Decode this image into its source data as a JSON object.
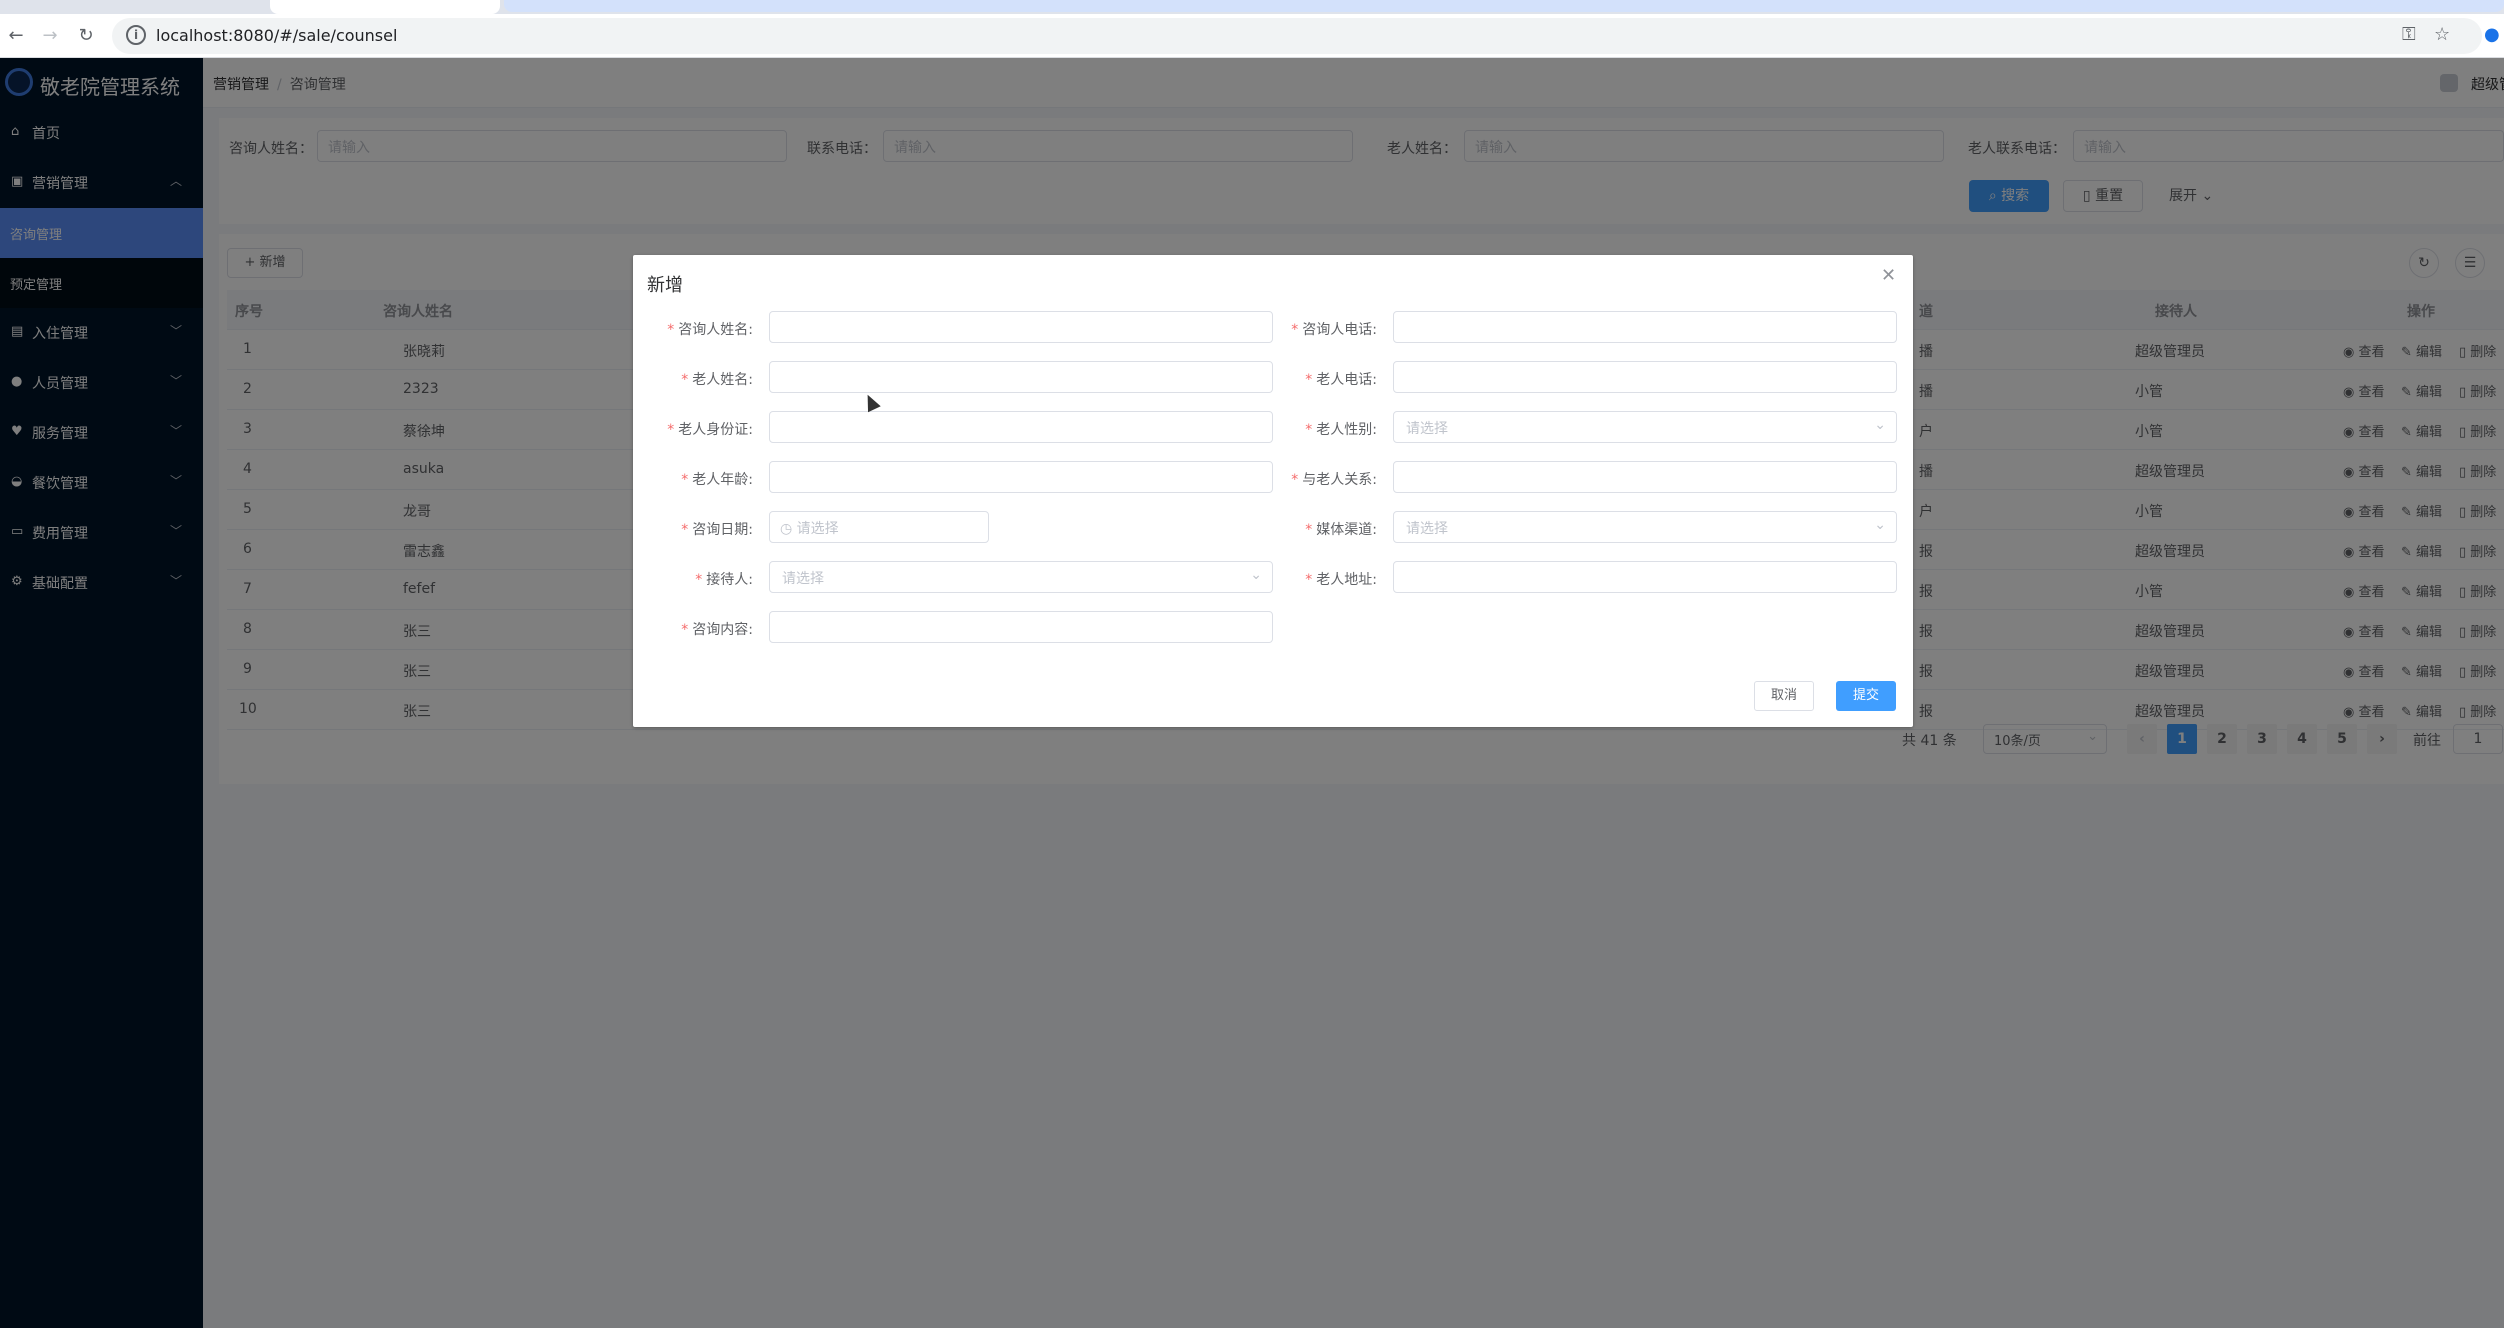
{
  "browser": {
    "url": "localhost:8080/#/sale/counsel"
  },
  "app": {
    "title": "敬老院管理系统",
    "breadcrumb": [
      "营销管理",
      "咨询管理"
    ],
    "user_name": "超级管理员"
  },
  "sidebar": {
    "items": [
      {
        "label": "首页",
        "icon": "home-icon"
      },
      {
        "label": "营销管理",
        "icon": "chart-icon",
        "expanded": true
      },
      {
        "label": "入住管理",
        "icon": "checkin-icon"
      },
      {
        "label": "人员管理",
        "icon": "user-icon"
      },
      {
        "label": "服务管理",
        "icon": "service-icon"
      },
      {
        "label": "餐饮管理",
        "icon": "food-icon"
      },
      {
        "label": "费用管理",
        "icon": "money-icon"
      },
      {
        "label": "基础配置",
        "icon": "gear-icon"
      }
    ],
    "sub_items": [
      {
        "label": "咨询管理",
        "active": true
      },
      {
        "label": "预定管理",
        "active": false
      }
    ]
  },
  "search": {
    "fields": [
      {
        "label": "咨询人姓名：",
        "placeholder": "请输入"
      },
      {
        "label": "联系电话：",
        "placeholder": "请输入"
      },
      {
        "label": "老人姓名：",
        "placeholder": "请输入"
      },
      {
        "label": "老人联系电话：",
        "placeholder": "请输入"
      }
    ],
    "search_label": "搜索",
    "reset_label": "重置",
    "expand_label": "展开"
  },
  "table": {
    "add_label": "+ 新增",
    "columns": {
      "index": "序号",
      "name": "咨询人姓名",
      "channel_fragment": "道",
      "receptionist": "接待人",
      "actions": "操作"
    },
    "actions": {
      "view": "查看",
      "edit": "编辑",
      "delete": "删除"
    },
    "rows": [
      {
        "index": "1",
        "name": "张晓莉",
        "channel_fragment": "播",
        "receptionist": "超级管理员"
      },
      {
        "index": "2",
        "name": "2323",
        "channel_fragment": "播",
        "receptionist": "小管"
      },
      {
        "index": "3",
        "name": "蔡徐坤",
        "channel_fragment": "户",
        "receptionist": "小管"
      },
      {
        "index": "4",
        "name": "asuka",
        "channel_fragment": "播",
        "receptionist": "超级管理员"
      },
      {
        "index": "5",
        "name": "龙哥",
        "channel_fragment": "户",
        "receptionist": "小管"
      },
      {
        "index": "6",
        "name": "雷志鑫",
        "channel_fragment": "报",
        "receptionist": "超级管理员"
      },
      {
        "index": "7",
        "name": "fefef",
        "channel_fragment": "报",
        "receptionist": "小管"
      },
      {
        "index": "8",
        "name": "张三",
        "channel_fragment": "报",
        "receptionist": "超级管理员"
      },
      {
        "index": "9",
        "name": "张三",
        "channel_fragment": "报",
        "receptionist": "超级管理员"
      },
      {
        "index": "10",
        "name": "张三",
        "channel_fragment": "报",
        "receptionist": "超级管理员"
      }
    ]
  },
  "pagination": {
    "total": "共 41 条",
    "page_size": "10条/页",
    "pages": [
      "1",
      "2",
      "3",
      "4",
      "5"
    ],
    "current": "1",
    "goto_label": "前往",
    "goto_value": "1"
  },
  "dialog": {
    "title": "新增",
    "fields": {
      "counselor_name": "咨询人姓名:",
      "counselor_phone": "咨询人电话:",
      "elder_name": "老人姓名:",
      "elder_phone": "老人电话:",
      "elder_id": "老人身份证:",
      "elder_gender": "老人性别:",
      "elder_age": "老人年龄:",
      "relation": "与老人关系:",
      "consult_date": "咨询日期:",
      "media_channel": "媒体渠道:",
      "receptionist": "接待人:",
      "elder_address": "老人地址:",
      "consult_content": "咨询内容:"
    },
    "select_placeholder": "请选择",
    "cancel_label": "取消",
    "submit_label": "提交"
  },
  "colors": {
    "sidebar_bg": "#001529",
    "primary": "#409eff",
    "active_menu": "#5b8ff9",
    "required": "#f56c6c"
  }
}
